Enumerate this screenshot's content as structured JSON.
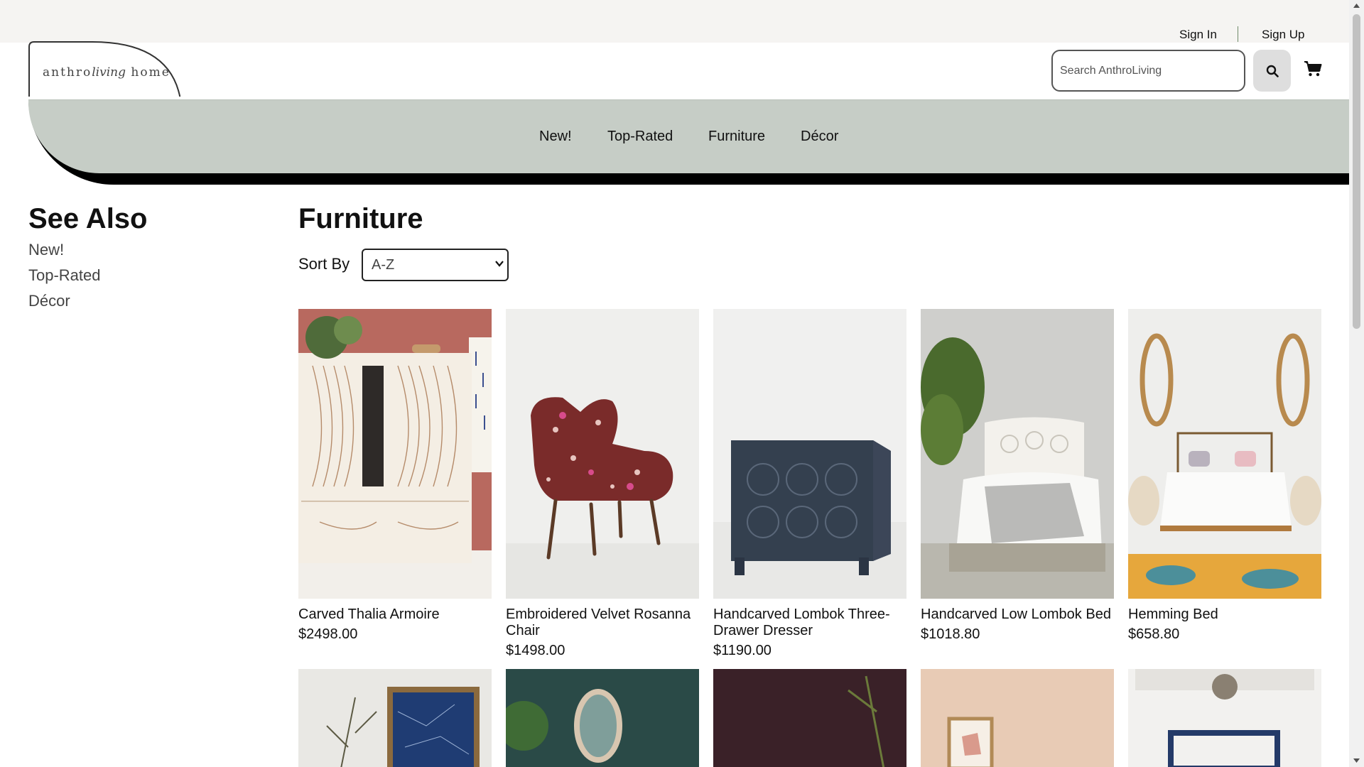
{
  "utility": {
    "sign_in": "Sign In",
    "sign_up": "Sign Up"
  },
  "logo": {
    "left": "anthro",
    "script": "living",
    "right": "home"
  },
  "search": {
    "placeholder": "Search AnthroLiving",
    "value": ""
  },
  "nav": {
    "items": [
      "New!",
      "Top-Rated",
      "Furniture",
      "Décor"
    ]
  },
  "sidebar": {
    "title": "See Also",
    "links": [
      "New!",
      "Top-Rated",
      "Décor"
    ]
  },
  "main": {
    "title": "Furniture",
    "sort_label": "Sort By",
    "sort_selected": "A-Z"
  },
  "products": [
    {
      "name": "Carved Thalia Armoire",
      "price": "$2498.00"
    },
    {
      "name": "Embroidered Velvet Rosanna Chair",
      "price": "$1498.00"
    },
    {
      "name": "Handcarved Lombok Three-Drawer Dresser",
      "price": "$1190.00"
    },
    {
      "name": "Handcarved Low Lombok Bed",
      "price": "$1018.80"
    },
    {
      "name": "Hemming Bed",
      "price": "$658.80"
    }
  ],
  "colors": {
    "nav_band": "#c6cdc6",
    "utility_bar": "#f5f4f2",
    "accent_separator": "#6f8a6a"
  },
  "icons": [
    "search-icon",
    "cart-icon",
    "chevron-down-icon"
  ]
}
